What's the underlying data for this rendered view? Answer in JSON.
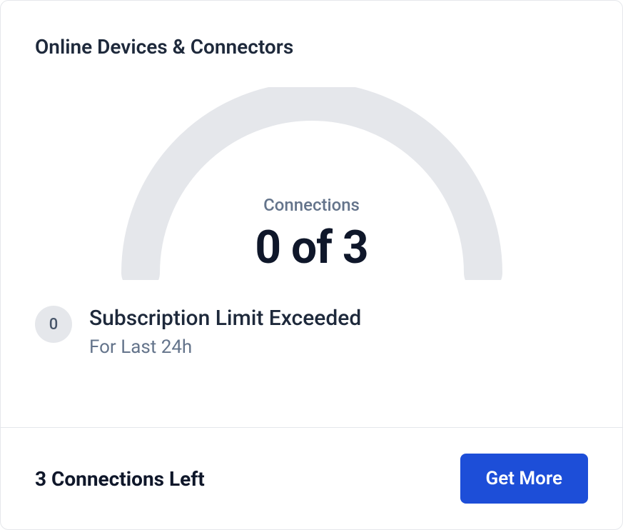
{
  "card": {
    "title": "Online Devices & Connectors",
    "gauge": {
      "label": "Connections",
      "value": "0 of 3",
      "current": 0,
      "max": 3
    },
    "status": {
      "badge_value": "0",
      "title": "Subscription Limit Exceeded",
      "subtitle": "For Last 24h"
    },
    "footer": {
      "left_text": "3 Connections Left",
      "button_label": "Get More"
    }
  },
  "colors": {
    "gauge_track": "#e5e7eb",
    "primary": "#1d4ed8",
    "text_primary": "#0f172a",
    "text_secondary": "#64748b"
  }
}
